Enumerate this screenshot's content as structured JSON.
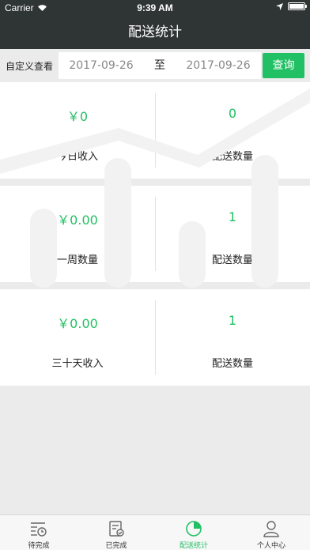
{
  "status_bar": {
    "carrier": "Carrier",
    "time": "9:39 AM"
  },
  "navbar": {
    "title": "配送统计"
  },
  "filter": {
    "label": "自定义查看",
    "date_from": "2017-09-26",
    "separator": "至",
    "date_to": "2017-09-26",
    "query_label": "查询"
  },
  "cards": [
    {
      "left_value": "￥0",
      "left_caption": "今日收入",
      "right_value": "0",
      "right_caption": "配送数量"
    },
    {
      "left_value": "￥0.00",
      "left_caption": "一周数量",
      "right_value": "1",
      "right_caption": "配送数量"
    },
    {
      "left_value": "￥0.00",
      "left_caption": "三十天收入",
      "right_value": "1",
      "right_caption": "配送数量"
    }
  ],
  "tabs": [
    {
      "label": "待完成",
      "icon": "pending-icon",
      "active": false
    },
    {
      "label": "已完成",
      "icon": "completed-icon",
      "active": false
    },
    {
      "label": "配送统计",
      "icon": "pie-chart-icon",
      "active": true
    },
    {
      "label": "个人中心",
      "icon": "user-icon",
      "active": false
    }
  ],
  "colors": {
    "accent": "#22c064",
    "header": "#2f3434",
    "background": "#ebebeb"
  }
}
